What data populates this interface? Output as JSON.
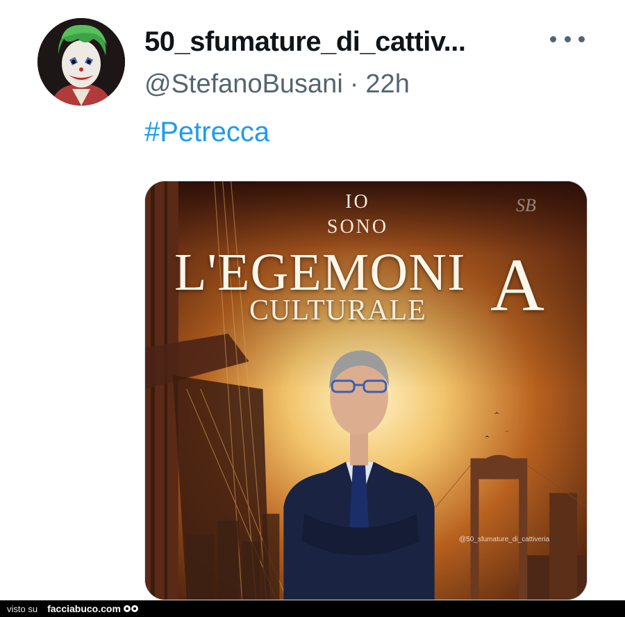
{
  "tweet": {
    "display_name": "50_sfumature_di_cattiv...",
    "handle": "@StefanoBusani",
    "separator": "·",
    "time": "22h",
    "hashtag": "#Petrecca",
    "avatar_icon": "joker-avatar",
    "more_icon": "more-options-icon",
    "hashtag_color": "#1d9bf0"
  },
  "media": {
    "line1": "IO",
    "line2": "SONO",
    "title": "L'EGEMONI",
    "title_big_letter": "A",
    "subtitle": "CULTURALE",
    "signature": "SB",
    "watermark_handle": "@50_sfumature_di_cattiveria"
  },
  "footer": {
    "prefix": "visto su",
    "site": "facciabuco.com"
  }
}
